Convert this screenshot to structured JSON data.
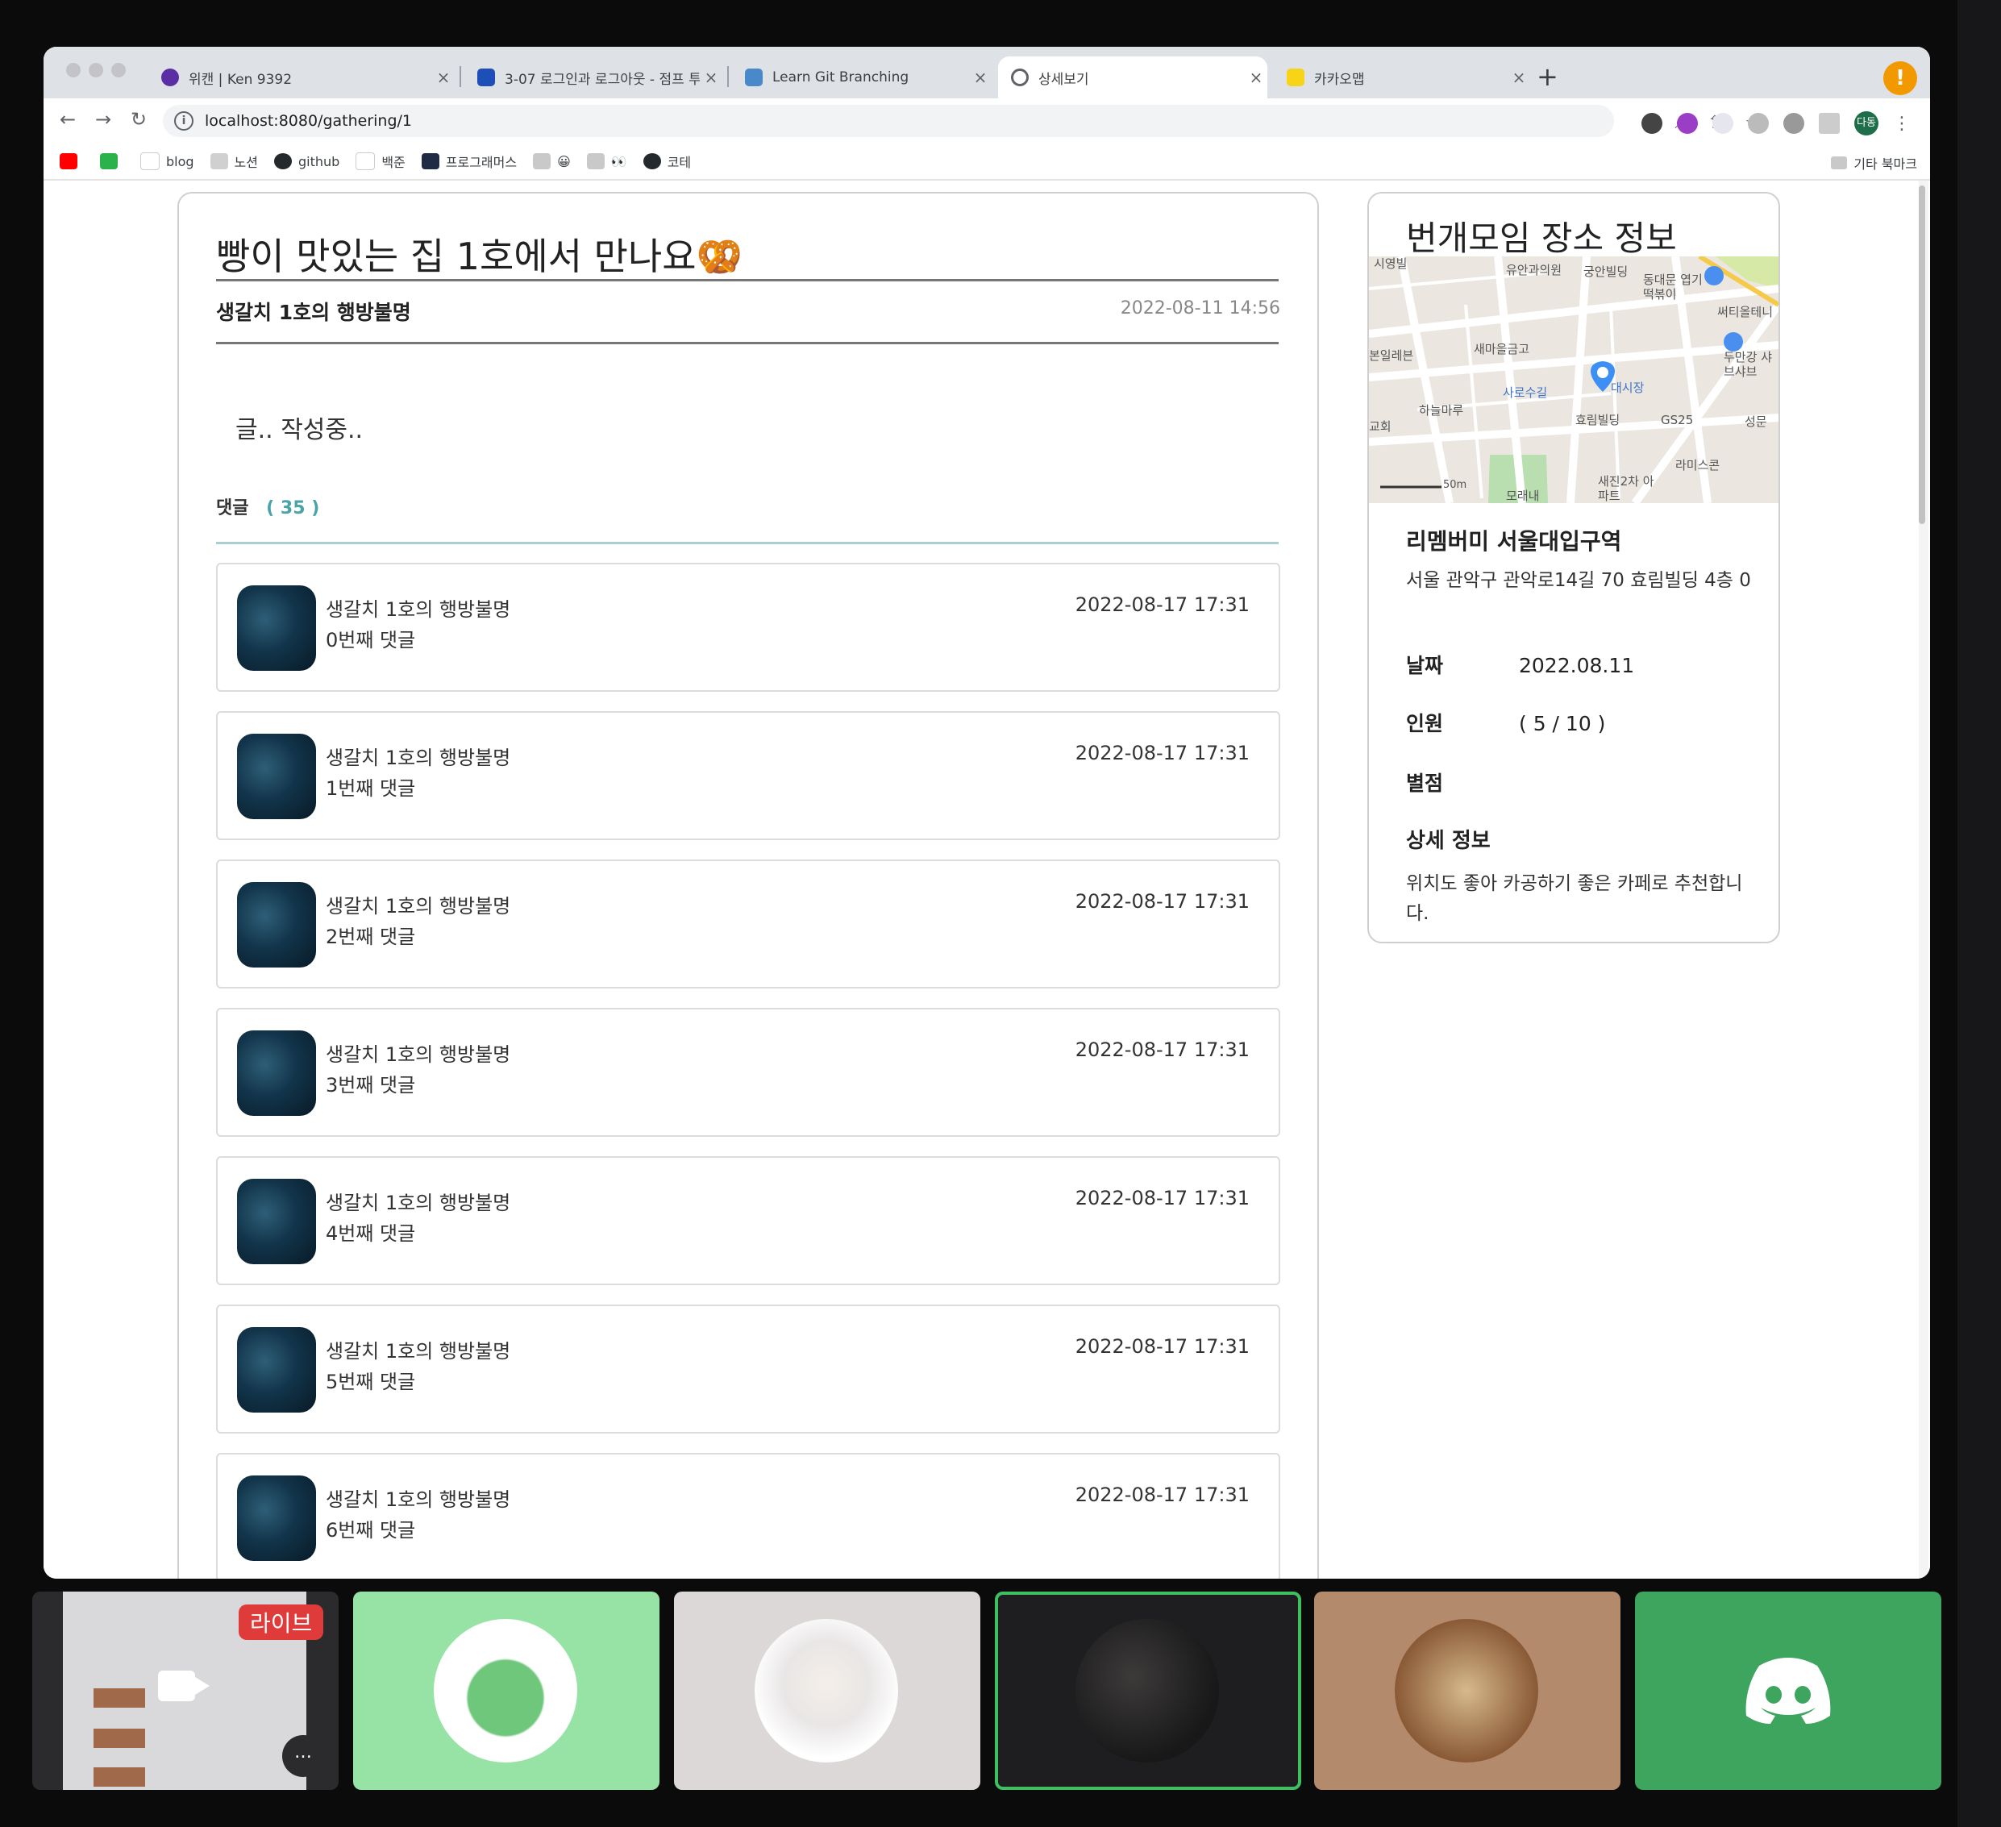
{
  "browser": {
    "tabs": [
      {
        "title": "위캔 | Ken 9392",
        "fav_color": "#5b2ea6"
      },
      {
        "title": "3-07 로그인과 로그아웃 - 점프 투 스프",
        "fav_color": "#1e4fb8"
      },
      {
        "title": "Learn Git Branching",
        "fav_color": "#4a89c9"
      },
      {
        "title": "상세보기",
        "fav_color": "#5f6368"
      },
      {
        "title": "카카오맵",
        "fav_color": "#f7d417"
      }
    ],
    "url": "localhost:8080/gathering/1",
    "avatar_label": "다동",
    "bookmarks": [
      {
        "label": "",
        "color": "#ff0000"
      },
      {
        "label": "",
        "color": "#2bb24c"
      },
      {
        "label": "blog",
        "color": "#ffffff"
      },
      {
        "label": "노션",
        "color": "#d0d0d0"
      },
      {
        "label": "github",
        "color": "#24292e"
      },
      {
        "label": "백준",
        "color": "#ffffff"
      },
      {
        "label": "프로그래머스",
        "color": "#1f2a44"
      },
      {
        "label": "😀",
        "color": "#c9c9c9"
      },
      {
        "label": "👀",
        "color": "#c9c9c9"
      },
      {
        "label": "코테",
        "color": "#24292e"
      }
    ],
    "other_bookmarks": "기타 북마크"
  },
  "post": {
    "title": "빵이 맛있는 집 1호에서 만나요🥨",
    "author": "생갈치 1호의 행방불명",
    "date": "2022-08-11 14:56",
    "body": "글.. 작성중..",
    "comments_label": "댓글",
    "comments_open": "(",
    "comments_count": "35",
    "comments_close": ")",
    "comments": [
      {
        "name": "생갈치 1호의 행방불명",
        "text": "0번째 댓글",
        "date": "2022-08-17 17:31"
      },
      {
        "name": "생갈치 1호의 행방불명",
        "text": "1번째 댓글",
        "date": "2022-08-17 17:31"
      },
      {
        "name": "생갈치 1호의 행방불명",
        "text": "2번째 댓글",
        "date": "2022-08-17 17:31"
      },
      {
        "name": "생갈치 1호의 행방불명",
        "text": "3번째 댓글",
        "date": "2022-08-17 17:31"
      },
      {
        "name": "생갈치 1호의 행방불명",
        "text": "4번째 댓글",
        "date": "2022-08-17 17:31"
      },
      {
        "name": "생갈치 1호의 행방불명",
        "text": "5번째 댓글",
        "date": "2022-08-17 17:31"
      },
      {
        "name": "생갈치 1호의 행방불명",
        "text": "6번째 댓글",
        "date": "2022-08-17 17:31"
      }
    ]
  },
  "place": {
    "title": "번개모임 장소 정보",
    "map_labels": [
      "유안과의원",
      "궁안빌딩",
      "동대문 엽기떡볶이",
      "써티올테니",
      "두만강 샤브샤브",
      "새마을금고",
      "사로수길",
      "대시장",
      "하늘마루",
      "효림빌딩",
      "GS25",
      "성문",
      "라미스콘",
      "새진2차 아파트",
      "모래내",
      "50m",
      "본일레븐",
      "시영빌",
      "교회"
    ],
    "name": "리멤버미 서울대입구역",
    "address": "서울 관악구 관악로14길 70 효림빌딩 4층 0",
    "date_label": "날짜",
    "date_value": "2022.08.11",
    "people_label": "인원",
    "people_value": "( 5 / 10 )",
    "rating_label": "별점",
    "detail_label": "상세 정보",
    "detail_text": "위치도 좋아 카공하기 좋은 카페로 추천합니다."
  },
  "call": {
    "live_badge": "라이브",
    "tile_colors": [
      "#2b2b2e",
      "#97e3a6",
      "#ddd8d8",
      "#1e1e21",
      "#b48a6c",
      "#3da55d"
    ],
    "speaking_border": "#3fbf5f"
  }
}
